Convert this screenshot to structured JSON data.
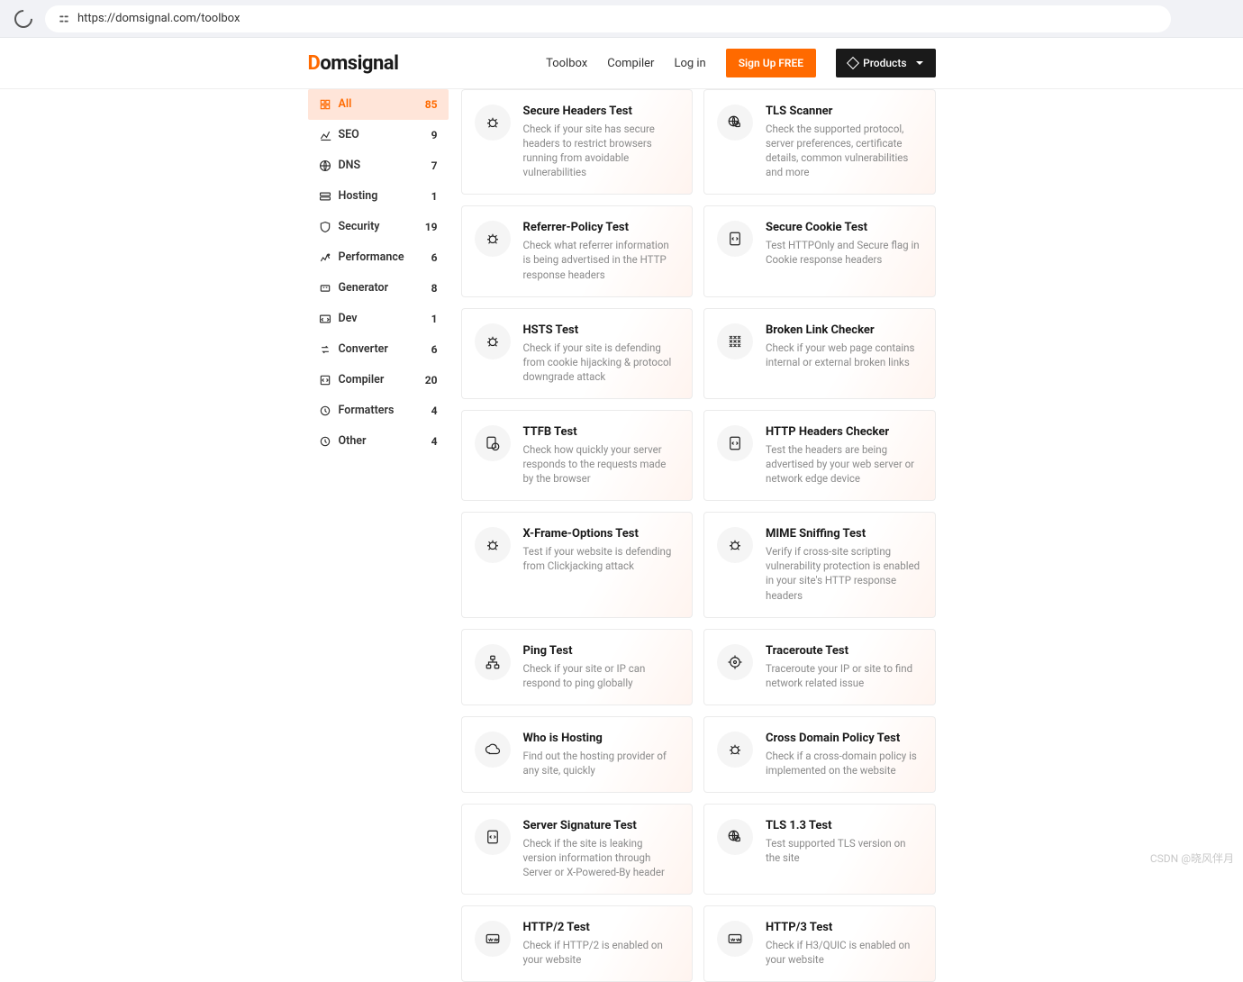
{
  "browser": {
    "url": "https://domsignal.com/toolbox"
  },
  "brand": {
    "name_prefix": "D",
    "name_rest": "omsignal"
  },
  "nav": {
    "toolbox": "Toolbox",
    "compiler": "Compiler",
    "login": "Log in",
    "signup": "Sign Up FREE",
    "products": "Products"
  },
  "sidebar": {
    "items": [
      {
        "label": "All",
        "count": "85",
        "active": true
      },
      {
        "label": "SEO",
        "count": "9",
        "active": false
      },
      {
        "label": "DNS",
        "count": "7",
        "active": false
      },
      {
        "label": "Hosting",
        "count": "1",
        "active": false
      },
      {
        "label": "Security",
        "count": "19",
        "active": false
      },
      {
        "label": "Performance",
        "count": "6",
        "active": false
      },
      {
        "label": "Generator",
        "count": "8",
        "active": false
      },
      {
        "label": "Dev",
        "count": "1",
        "active": false
      },
      {
        "label": "Converter",
        "count": "6",
        "active": false
      },
      {
        "label": "Compiler",
        "count": "20",
        "active": false
      },
      {
        "label": "Formatters",
        "count": "4",
        "active": false
      },
      {
        "label": "Other",
        "count": "4",
        "active": false
      }
    ]
  },
  "cards": [
    {
      "title": "Secure Headers Test",
      "desc": "Check if your site has secure headers to restrict browsers running from avoidable vulnerabilities",
      "icon": "bug"
    },
    {
      "title": "TLS Scanner",
      "desc": "Check the supported protocol, server preferences, certificate details, common vulnerabilities and more",
      "icon": "globe-lock"
    },
    {
      "title": "Referrer-Policy Test",
      "desc": "Check what referrer information is being advertised in the HTTP response headers",
      "icon": "bug"
    },
    {
      "title": "Secure Cookie Test",
      "desc": "Test HTTPOnly and Secure flag in Cookie response headers",
      "icon": "code-file"
    },
    {
      "title": "HSTS Test",
      "desc": "Check if your site is defending from cookie hijacking & protocol downgrade attack",
      "icon": "bug"
    },
    {
      "title": "Broken Link Checker",
      "desc": "Check if your web page contains internal or external broken links",
      "icon": "slash"
    },
    {
      "title": "TTFB Test",
      "desc": "Check how quickly your server responds to the requests made by the browser",
      "icon": "file-clock"
    },
    {
      "title": "HTTP Headers Checker",
      "desc": "Test the headers are being advertised by your web server or network edge device",
      "icon": "code-file"
    },
    {
      "title": "X-Frame-Options Test",
      "desc": "Test if your website is defending from Clickjacking attack",
      "icon": "bug"
    },
    {
      "title": "MIME Sniffing Test",
      "desc": "Verify if cross-site scripting vulnerability protection is enabled in your site's HTTP response headers",
      "icon": "bug"
    },
    {
      "title": "Ping Test",
      "desc": "Check if your site or IP can respond to ping globally",
      "icon": "network"
    },
    {
      "title": "Traceroute Test",
      "desc": "Traceroute your IP or site to find network related issue",
      "icon": "target"
    },
    {
      "title": "Who is Hosting",
      "desc": "Find out the hosting provider of any site, quickly",
      "icon": "cloud"
    },
    {
      "title": "Cross Domain Policy Test",
      "desc": "Check if a cross-domain policy is implemented on the website",
      "icon": "bug"
    },
    {
      "title": "Server Signature Test",
      "desc": "Check if the site is leaking version information through Server or X-Powered-By header",
      "icon": "code-file"
    },
    {
      "title": "TLS 1.3 Test",
      "desc": "Test supported TLS version on the site",
      "icon": "globe-lock"
    },
    {
      "title": "HTTP/2 Test",
      "desc": "Check if HTTP/2 is enabled on your website",
      "icon": "www"
    },
    {
      "title": "HTTP/3 Test",
      "desc": "Check if H3/QUIC is enabled on your website",
      "icon": "www"
    }
  ],
  "watermark": "CSDN @晓风伴月"
}
